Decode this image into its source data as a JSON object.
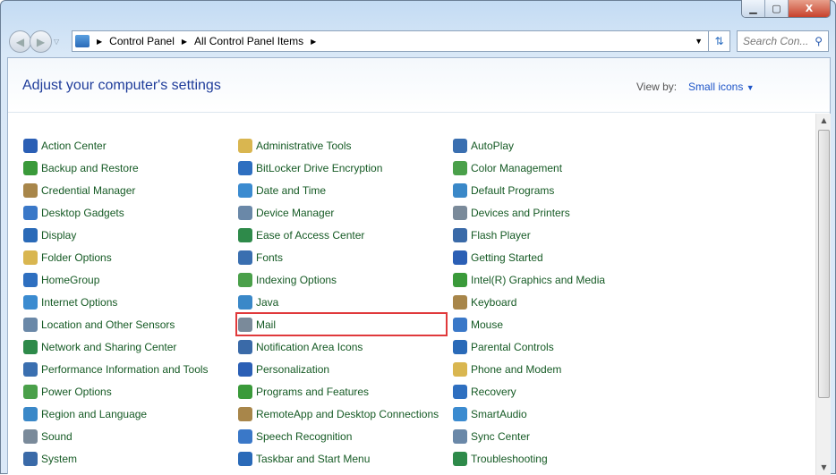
{
  "window": {
    "controls": [
      "minimize",
      "maximize",
      "close"
    ]
  },
  "address": {
    "crumbs": [
      "Control Panel",
      "All Control Panel Items"
    ]
  },
  "search": {
    "placeholder": "Search Con..."
  },
  "header": {
    "title": "Adjust your computer's settings",
    "view_by_label": "View by:",
    "view_by_value": "Small icons"
  },
  "highlight_item": "Mail",
  "highlight_color": "#e0393b",
  "link_color": "#155a24",
  "columns": [
    [
      "Action Center",
      "Backup and Restore",
      "Credential Manager",
      "Desktop Gadgets",
      "Display",
      "Folder Options",
      "HomeGroup",
      "Internet Options",
      "Location and Other Sensors",
      "Network and Sharing Center",
      "Performance Information and Tools",
      "Power Options",
      "Region and Language",
      "Sound",
      "System"
    ],
    [
      "Administrative Tools",
      "BitLocker Drive Encryption",
      "Date and Time",
      "Device Manager",
      "Ease of Access Center",
      "Fonts",
      "Indexing Options",
      "Java",
      "Mail",
      "Notification Area Icons",
      "Personalization",
      "Programs and Features",
      "RemoteApp and Desktop Connections",
      "Speech Recognition",
      "Taskbar and Start Menu"
    ],
    [
      "AutoPlay",
      "Color Management",
      "Default Programs",
      "Devices and Printers",
      "Flash Player",
      "Getting Started",
      "Intel(R) Graphics and Media",
      "Keyboard",
      "Mouse",
      "Parental Controls",
      "Phone and Modem",
      "Recovery",
      "SmartAudio",
      "Sync Center",
      "Troubleshooting"
    ]
  ],
  "icon_colors": [
    "#2b5fb5",
    "#3a9a3a",
    "#a8864a",
    "#3a78c8",
    "#2a6ab8",
    "#d9b650",
    "#2e6fc0",
    "#3b8bd0",
    "#6a88a8",
    "#2e8a4a",
    "#3a6fb0",
    "#4aa04a",
    "#3a88c8",
    "#7a8a9a",
    "#3a6aa8"
  ]
}
